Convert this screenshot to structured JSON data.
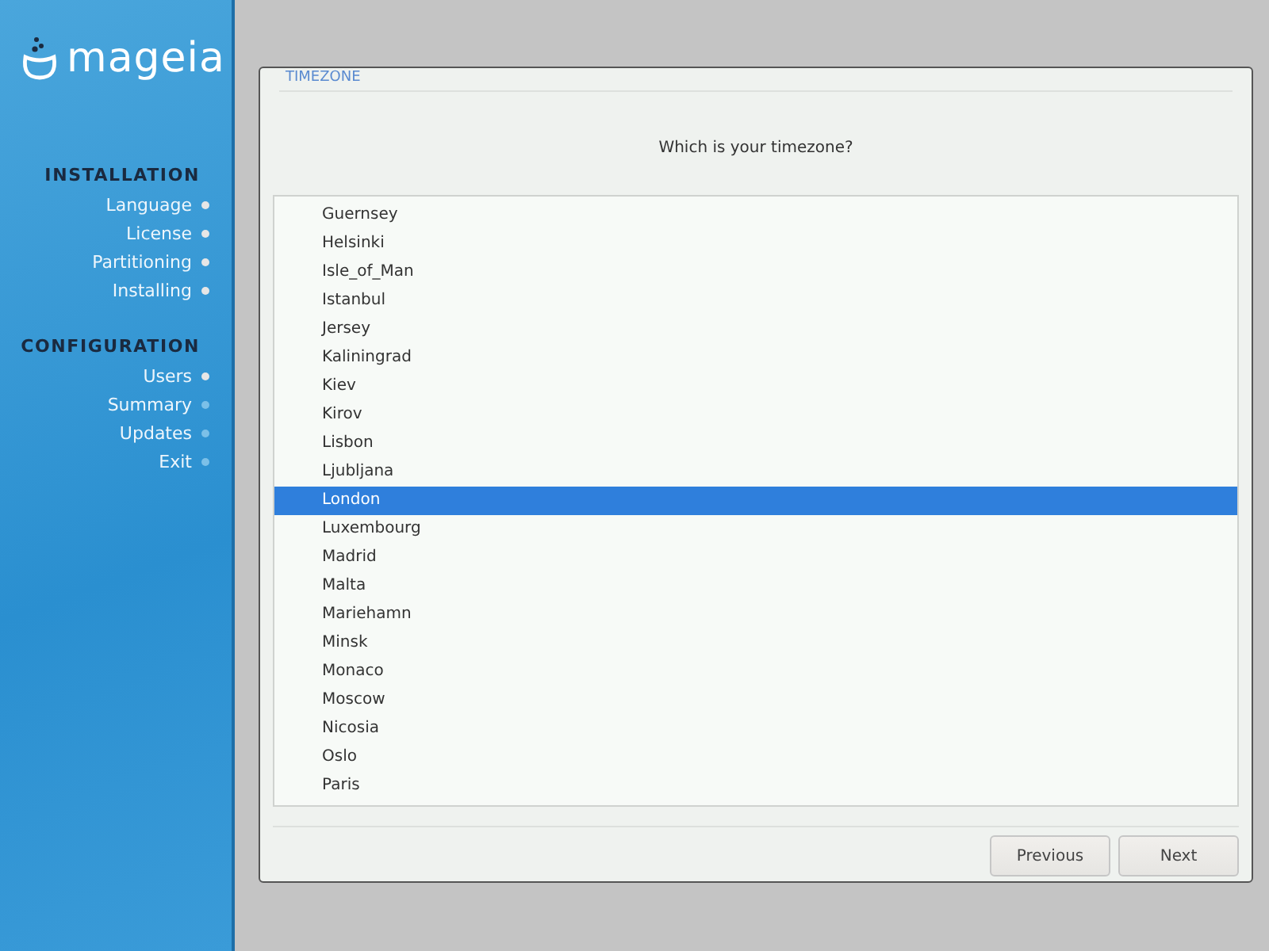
{
  "logo": {
    "text": "mageia"
  },
  "sidebar": {
    "sections": [
      {
        "title": "INSTALLATION",
        "items": [
          {
            "label": "Language",
            "done": true
          },
          {
            "label": "License",
            "done": true
          },
          {
            "label": "Partitioning",
            "done": true
          },
          {
            "label": "Installing",
            "done": true
          }
        ]
      },
      {
        "title": "CONFIGURATION",
        "items": [
          {
            "label": "Users",
            "done": true
          },
          {
            "label": "Summary",
            "done": false
          },
          {
            "label": "Updates",
            "done": false
          },
          {
            "label": "Exit",
            "done": false
          }
        ]
      }
    ]
  },
  "dialog": {
    "title": "TIMEZONE",
    "question": "Which is your timezone?",
    "timezones": [
      {
        "label": "Guernsey",
        "selected": false
      },
      {
        "label": "Helsinki",
        "selected": false
      },
      {
        "label": "Isle_of_Man",
        "selected": false
      },
      {
        "label": "Istanbul",
        "selected": false
      },
      {
        "label": "Jersey",
        "selected": false
      },
      {
        "label": "Kaliningrad",
        "selected": false
      },
      {
        "label": "Kiev",
        "selected": false
      },
      {
        "label": "Kirov",
        "selected": false
      },
      {
        "label": "Lisbon",
        "selected": false
      },
      {
        "label": "Ljubljana",
        "selected": false
      },
      {
        "label": "London",
        "selected": true
      },
      {
        "label": "Luxembourg",
        "selected": false
      },
      {
        "label": "Madrid",
        "selected": false
      },
      {
        "label": "Malta",
        "selected": false
      },
      {
        "label": "Mariehamn",
        "selected": false
      },
      {
        "label": "Minsk",
        "selected": false
      },
      {
        "label": "Monaco",
        "selected": false
      },
      {
        "label": "Moscow",
        "selected": false
      },
      {
        "label": "Nicosia",
        "selected": false
      },
      {
        "label": "Oslo",
        "selected": false
      },
      {
        "label": "Paris",
        "selected": false
      }
    ],
    "buttons": [
      "Previous",
      "Next"
    ]
  }
}
